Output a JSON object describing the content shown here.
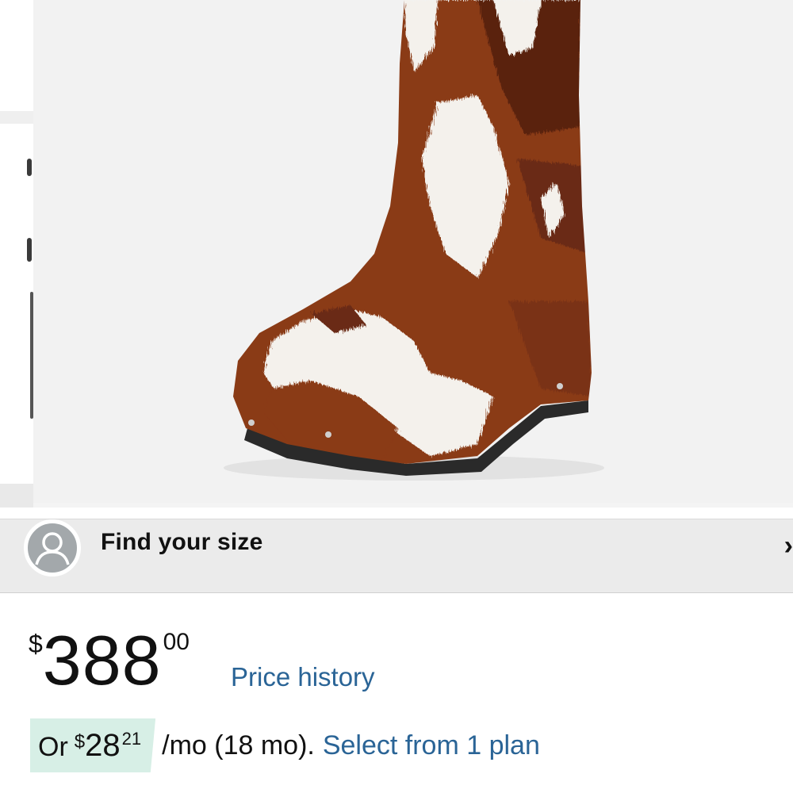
{
  "product": {
    "image_alt": "brown and white cowhide hoof boot",
    "colors": {
      "hide_brown": "#8a3a18",
      "hide_white": "#f4f1ec",
      "sole": "#2a2a2a",
      "background": "#f2f2f2"
    }
  },
  "size_finder": {
    "icon": "person-icon",
    "label": "Find your size",
    "chevron_icon": "chevron-right-icon"
  },
  "price": {
    "currency_symbol": "$",
    "whole": "388",
    "fraction": "00",
    "history_link": "Price history"
  },
  "installment": {
    "prefix": "Or",
    "currency_symbol": "$",
    "whole": "28",
    "fraction": "21",
    "term_text": "/mo (18 mo).",
    "plan_link": "Select from 1 plan",
    "badge_color": "#d7efe6"
  },
  "link_color": "#2a6496"
}
